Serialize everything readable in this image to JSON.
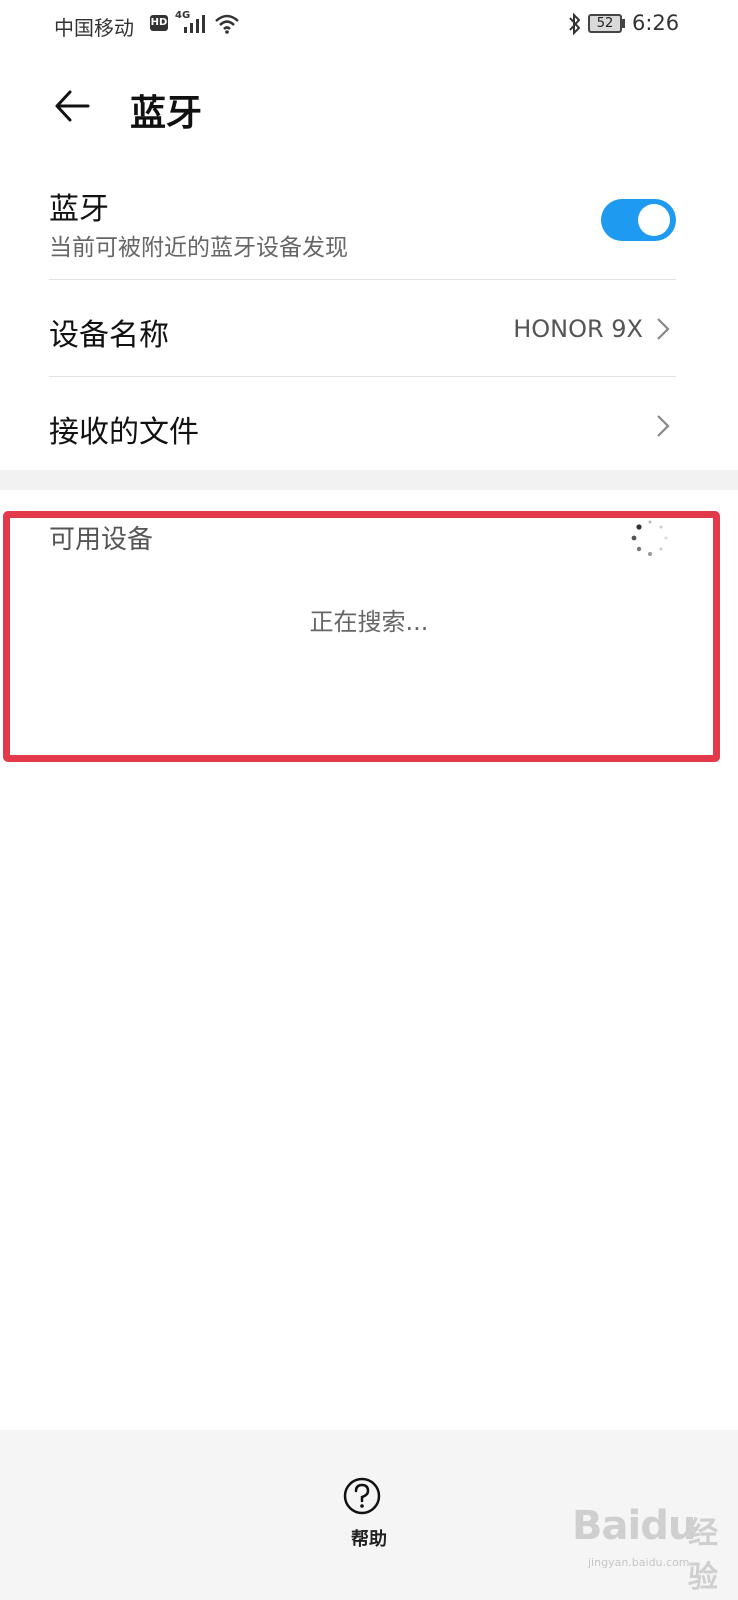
{
  "status_bar": {
    "carrier": "中国移动",
    "hd_badge": "HD",
    "network_type": "4G",
    "battery_level": "52",
    "time": "6:26"
  },
  "header": {
    "title": "蓝牙"
  },
  "bluetooth": {
    "label": "蓝牙",
    "subtitle": "当前可被附近的蓝牙设备发现",
    "enabled": true,
    "accent_color": "#1e9bf0"
  },
  "device_name": {
    "label": "设备名称",
    "value": "HONOR 9X"
  },
  "received_files": {
    "label": "接收的文件"
  },
  "available_devices": {
    "title": "可用设备",
    "status": "正在搜索..."
  },
  "bottom_bar": {
    "help_label": "帮助"
  },
  "watermark": {
    "brand": "Bai",
    "suffix": "du",
    "cn": "经验",
    "url": "jingyan.baidu.com"
  },
  "annotation": {
    "highlight_color": "#e23a4a"
  }
}
